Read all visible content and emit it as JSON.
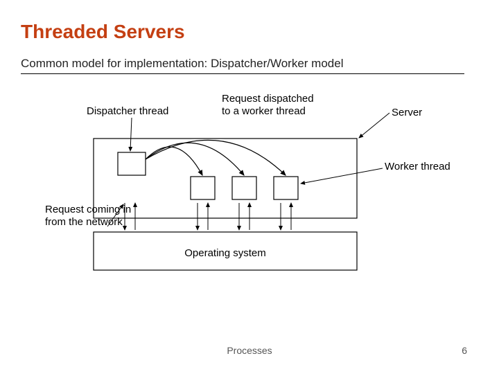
{
  "title": "Threaded Servers",
  "subtitle": "Common model for implementation: Dispatcher/Worker model",
  "labels": {
    "dispatcher": "Dispatcher thread",
    "dispatched_l1": "Request dispatched",
    "dispatched_l2": "to a worker thread",
    "server": "Server",
    "worker": "Worker thread",
    "incoming_l1": "Request coming in",
    "incoming_l2": "from the network",
    "os": "Operating system"
  },
  "footer": {
    "center": "Processes",
    "page": "6"
  }
}
